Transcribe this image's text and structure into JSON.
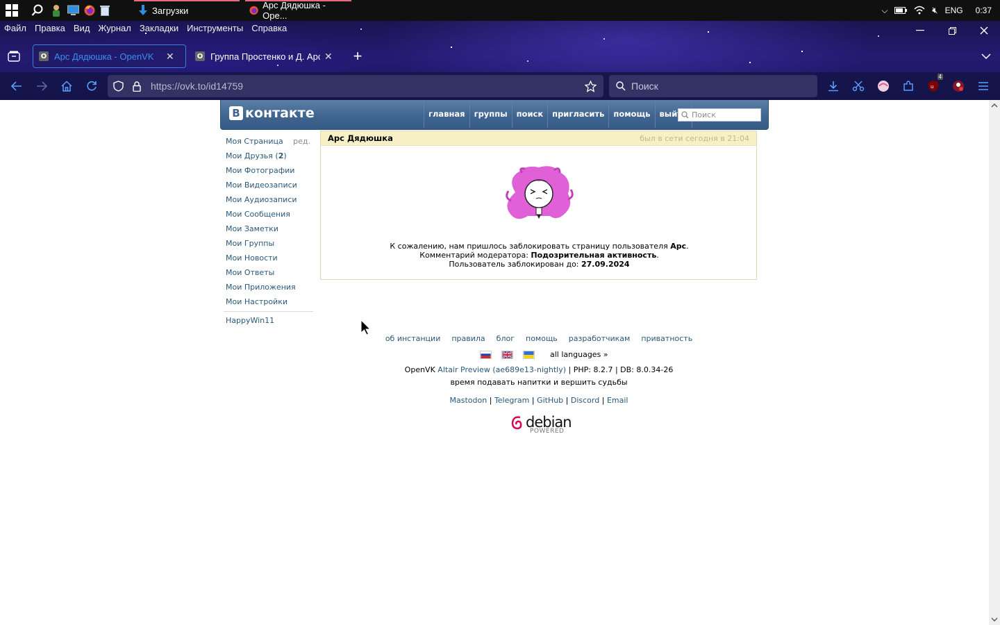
{
  "taskbar": {
    "tasks": [
      {
        "label": "Загрузки"
      },
      {
        "label": "Арс Дядюшка - Ope..."
      }
    ],
    "tray": {
      "lang": "ENG",
      "time": "0:37"
    }
  },
  "browser": {
    "menu": [
      "Файл",
      "Правка",
      "Вид",
      "Журнал",
      "Закладки",
      "Инструменты",
      "Справка"
    ],
    "tabs": [
      {
        "label": "Арс Дядюшка - OpenVK",
        "favicon": "O",
        "active": true
      },
      {
        "label": "Группа Простенко и Д. Арса",
        "favicon": "O",
        "active": false
      }
    ],
    "url": "https://ovk.to/id14759",
    "search_placeholder": "Поиск",
    "extension_badge": "4"
  },
  "site": {
    "logo": "контакте",
    "logo_letter": "B",
    "nav": [
      "главная",
      "группы",
      "поиск",
      "пригласить",
      "помощь",
      "выйти"
    ],
    "search_placeholder": "Поиск",
    "sidebar": [
      {
        "label": "Моя Страница",
        "extra": "ред."
      },
      {
        "label": "Мои Друзья",
        "count": "2"
      },
      {
        "label": "Мои Фотографии"
      },
      {
        "label": "Мои Видеозаписи"
      },
      {
        "label": "Мои Аудиозаписи"
      },
      {
        "label": "Мои Сообщения"
      },
      {
        "label": "Мои Заметки"
      },
      {
        "label": "Мои Группы"
      },
      {
        "label": "Мои Новости"
      },
      {
        "label": "Мои Ответы"
      },
      {
        "label": "Мои Приложения"
      },
      {
        "label": "Мои Настройки"
      }
    ],
    "sidebar_extra": "HappyWin11",
    "profile": {
      "name": "Арс Дядюшка",
      "status": "был в сети сегодня в 21:04",
      "ban_line1_prefix": "К сожалению, нам пришлось заблокировать страницу пользователя ",
      "ban_line1_name": "Арс",
      "ban_line1_suffix": ".",
      "ban_line2_prefix": "Комментарий модератора: ",
      "ban_line2_reason": "Подозрительная активность",
      "ban_line2_suffix": ".",
      "ban_line3_prefix": "Пользователь заблокирован до: ",
      "ban_line3_date": "27.09.2024"
    },
    "footer": {
      "links": [
        "об инстанции",
        "правила",
        "блог",
        "помощь",
        "разработчикам",
        "приватность"
      ],
      "all_languages": "all languages »",
      "version_prefix": "OpenVK ",
      "version_link": "Altair Preview (ae689e13-nightly)",
      "version_suffix": " | PHP: 8.2.7 | DB: 8.0.34-26",
      "motto": "время подавать напитки и вершить судьбы",
      "socials": [
        "Mastodon",
        "Telegram",
        "GitHub",
        "Discord",
        "Email"
      ],
      "debian_word": "debian",
      "debian_sub": "POWERED"
    }
  },
  "colors": {
    "vk_link": "#2b587a",
    "vk_header": "#3f6590",
    "profile_head_bg": "#f7f0c7",
    "tab_active": "#3d8cf0"
  }
}
